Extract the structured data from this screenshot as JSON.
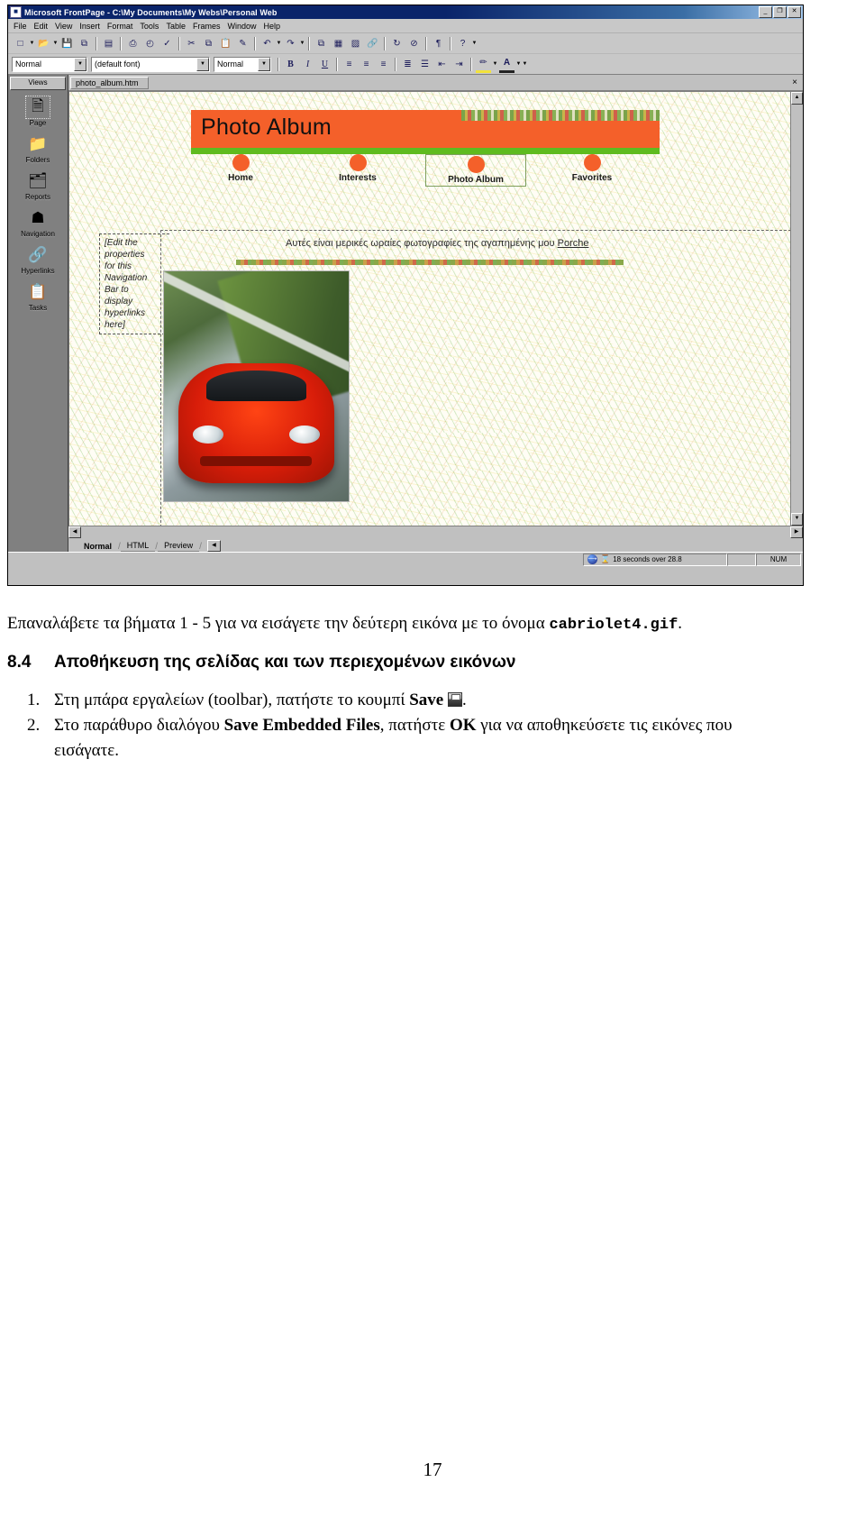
{
  "app": {
    "title": "Microsoft FrontPage - C:\\My Documents\\My Webs\\Personal Web",
    "title_icon": "frontpage-icon",
    "window_buttons": {
      "minimize": "_",
      "restore": "❐",
      "close": "✕"
    },
    "menus": [
      "File",
      "Edit",
      "View",
      "Insert",
      "Format",
      "Tools",
      "Table",
      "Frames",
      "Window",
      "Help"
    ],
    "standard_toolbar": [
      {
        "name": "new-page-icon",
        "glyph": "□"
      },
      {
        "name": "open-icon",
        "glyph": "📂"
      },
      {
        "name": "save-icon",
        "glyph": "💾"
      },
      {
        "name": "publish-web-icon",
        "glyph": "⧉"
      },
      {
        "name": "folder-list-icon",
        "glyph": "▤"
      },
      {
        "name": "print-icon",
        "glyph": "⎙"
      },
      {
        "name": "preview-in-browser-icon",
        "glyph": "◴"
      },
      {
        "name": "spelling-icon",
        "glyph": "✓"
      },
      {
        "name": "cut-icon",
        "glyph": "✂"
      },
      {
        "name": "copy-icon",
        "glyph": "⧉"
      },
      {
        "name": "paste-icon",
        "glyph": "📋"
      },
      {
        "name": "format-painter-icon",
        "glyph": "✎"
      },
      {
        "name": "undo-icon",
        "glyph": "↶"
      },
      {
        "name": "redo-icon",
        "glyph": "↷"
      },
      {
        "name": "insert-component-icon",
        "glyph": "⧉"
      },
      {
        "name": "insert-table-icon",
        "glyph": "▦"
      },
      {
        "name": "insert-picture-icon",
        "glyph": "▨"
      },
      {
        "name": "hyperlink-icon",
        "glyph": "🔗"
      },
      {
        "name": "refresh-icon",
        "glyph": "↻"
      },
      {
        "name": "stop-icon",
        "glyph": "⊘"
      },
      {
        "name": "show-marks-icon",
        "glyph": "¶"
      },
      {
        "name": "help-icon",
        "glyph": "?"
      }
    ],
    "format_toolbar": {
      "style_value": "Normal",
      "font_value": "(default font)",
      "size_value": "Normal",
      "buttons": [
        {
          "name": "bold-button",
          "glyph": "B"
        },
        {
          "name": "italic-button",
          "glyph": "I"
        },
        {
          "name": "underline-button",
          "glyph": "U"
        },
        {
          "name": "align-left-button",
          "glyph": "≡"
        },
        {
          "name": "align-center-button",
          "glyph": "≡"
        },
        {
          "name": "align-right-button",
          "glyph": "≡"
        },
        {
          "name": "numbered-list-button",
          "glyph": "≣"
        },
        {
          "name": "bulleted-list-button",
          "glyph": "☰"
        },
        {
          "name": "decrease-indent-button",
          "glyph": "⇤"
        },
        {
          "name": "increase-indent-button",
          "glyph": "⇥"
        },
        {
          "name": "highlight-button",
          "glyph": "✏"
        },
        {
          "name": "font-color-button",
          "glyph": "A"
        }
      ]
    },
    "views_panel": {
      "header": "Views",
      "items": [
        {
          "label": "Page",
          "icon": "page-view-icon",
          "glyph": "🗎",
          "selected": true
        },
        {
          "label": "Folders",
          "icon": "folders-view-icon",
          "glyph": "📁",
          "selected": false
        },
        {
          "label": "Reports",
          "icon": "reports-view-icon",
          "glyph": "🗂",
          "selected": false
        },
        {
          "label": "Navigation",
          "icon": "navigation-view-icon",
          "glyph": "☗",
          "selected": false
        },
        {
          "label": "Hyperlinks",
          "icon": "hyperlinks-view-icon",
          "glyph": "🔗",
          "selected": false
        },
        {
          "label": "Tasks",
          "icon": "tasks-view-icon",
          "glyph": "📋",
          "selected": false
        }
      ]
    },
    "document_tab": {
      "filename": "photo_album.htm",
      "close_glyph": "×"
    },
    "page_content": {
      "banner_title": "Photo Album",
      "nav_links": [
        {
          "label": "Home",
          "current": false
        },
        {
          "label": "Interests",
          "current": false
        },
        {
          "label": "Photo Album",
          "current": true
        },
        {
          "label": "Favorites",
          "current": false
        }
      ],
      "navbar_placeholder": [
        "[Edit the",
        "properties",
        "for this",
        "Navigation",
        "Bar to",
        "display",
        "hyperlinks",
        "here]"
      ],
      "caption_text": "Αυτές είναι μερικές ωραίες φωτογραφίες της αγαπημένης μου ",
      "caption_link": "Porche",
      "image_alt": "red-porsche-photo"
    },
    "view_tabs": [
      {
        "label": "Normal",
        "active": true
      },
      {
        "label": "HTML",
        "active": false
      },
      {
        "label": "Preview",
        "active": false
      }
    ],
    "status_bar": {
      "download_time": "18 seconds over 28.8",
      "num_lock": "NUM",
      "globe_icon": "globe-icon",
      "hourglass_icon": "hourglass-icon"
    },
    "colors": {
      "banner_orange": "#f4602a",
      "stripe_green": "#5fbb1f",
      "title_blue": "#0a246a",
      "chrome_gray": "#c0c0c0"
    }
  },
  "document": {
    "intro_prefix": "Επαναλάβετε τα βήματα 1 - 5 για να εισάγετε την δεύτερη εικόνα με το όνομα ",
    "intro_filename": "cabriolet4.gif",
    "intro_suffix": ".",
    "heading_number": "8.4",
    "heading_text": "Αποθήκευση της σελίδας και των περιεχομένων εικόνων",
    "steps": [
      {
        "number": "1.",
        "part1": "Στη μπάρα εργαλείων (toolbar), πατήστε το κουμπί ",
        "bold1": "Save",
        "icon": "save-icon",
        "part2": ".",
        "bold2": "",
        "part3": ""
      },
      {
        "number": "2.",
        "part1": "Στο παράθυρο διαλόγου ",
        "bold1": "Save Embedded Files",
        "icon": "",
        "part2": ", πατήστε ",
        "bold2": "OK",
        "part3": " για να αποθηκεύσετε τις εικόνες που εισάγατε."
      }
    ],
    "page_number": "17"
  }
}
